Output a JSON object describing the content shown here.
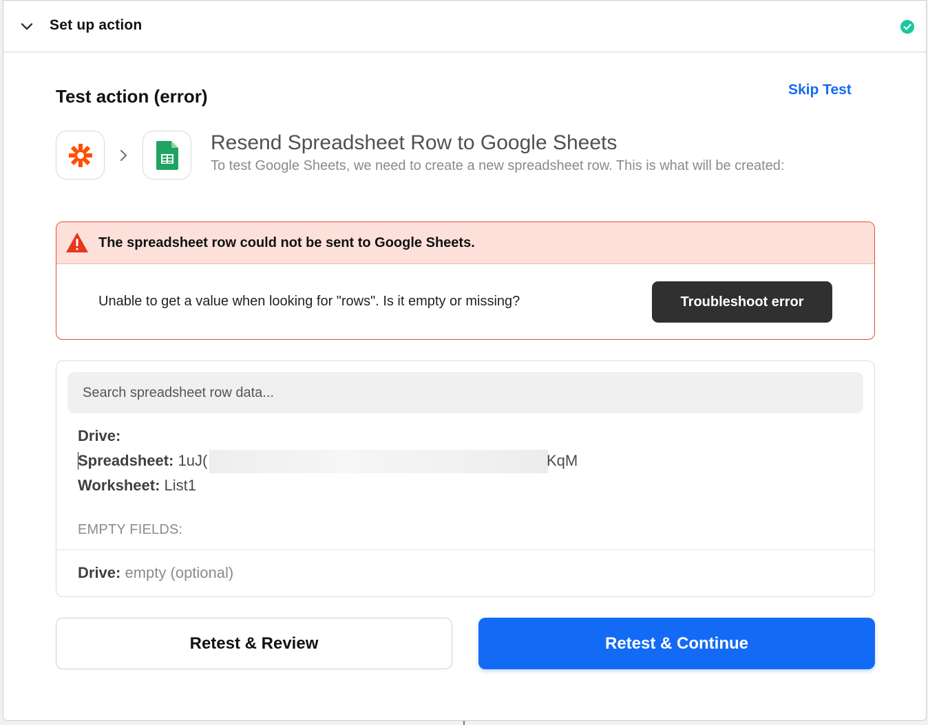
{
  "header": {
    "title": "Set up action",
    "status_icon": "check-circle-icon",
    "status_color": "#1cc6a1"
  },
  "test": {
    "title": "Test action (error)",
    "skip_label": "Skip Test"
  },
  "action": {
    "source_icon": "zapier-asterisk-icon",
    "source_color": "#ff4f00",
    "target_icon": "google-sheets-icon",
    "target_color": "#1ea362",
    "title": "Resend Spreadsheet Row to Google Sheets",
    "subtitle": "To test Google Sheets, we need to create a new spreadsheet row. This is what will be created:"
  },
  "error": {
    "heading": "The spreadsheet row could not be sent to Google Sheets.",
    "message": "Unable to get a value when looking for \"rows\". Is it empty or missing?",
    "button_label": "Troubleshoot error",
    "accent": "#e14a35"
  },
  "data": {
    "search_placeholder": "Search spreadsheet row data...",
    "fields": [
      {
        "key": "Drive:",
        "value": ""
      },
      {
        "key": "Spreadsheet:",
        "value_start": "1uJ(",
        "value_end": "KqM"
      },
      {
        "key": "Worksheet:",
        "value": "List1"
      }
    ],
    "empty_fields_label": "EMPTY FIELDS:",
    "empty_fields": [
      {
        "key": "Drive:",
        "value": "empty (optional)"
      }
    ]
  },
  "buttons": {
    "retest_review": "Retest & Review",
    "retest_continue": "Retest & Continue",
    "primary_color": "#136bf5"
  }
}
